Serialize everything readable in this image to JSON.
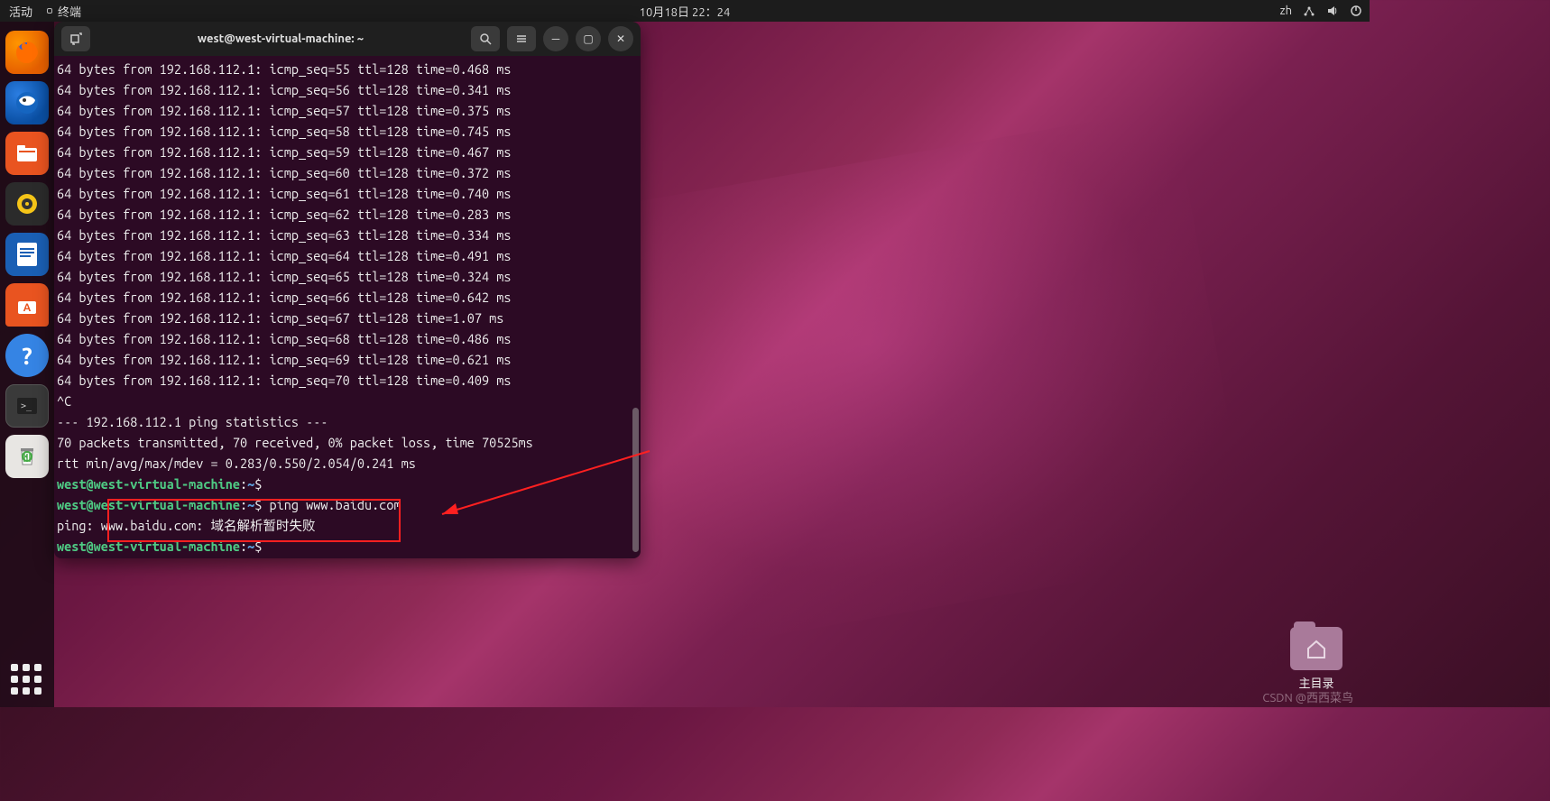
{
  "topbar": {
    "activities": "活动",
    "app_label": "终端",
    "datetime": "10月18日  22：24",
    "lang": "zh"
  },
  "dock": {
    "items": [
      {
        "name": "firefox"
      },
      {
        "name": "thunderbird"
      },
      {
        "name": "files"
      },
      {
        "name": "rhythmbox"
      },
      {
        "name": "libreoffice-writer"
      },
      {
        "name": "ubuntu-software"
      },
      {
        "name": "help"
      },
      {
        "name": "terminal"
      },
      {
        "name": "trash"
      }
    ]
  },
  "terminal": {
    "title": "west@west-virtual-machine: ~",
    "ping_ip": "192.168.112.1",
    "ping_lines": [
      {
        "seq": 55,
        "ttl": 128,
        "time": "0.468"
      },
      {
        "seq": 56,
        "ttl": 128,
        "time": "0.341"
      },
      {
        "seq": 57,
        "ttl": 128,
        "time": "0.375"
      },
      {
        "seq": 58,
        "ttl": 128,
        "time": "0.745"
      },
      {
        "seq": 59,
        "ttl": 128,
        "time": "0.467"
      },
      {
        "seq": 60,
        "ttl": 128,
        "time": "0.372"
      },
      {
        "seq": 61,
        "ttl": 128,
        "time": "0.740"
      },
      {
        "seq": 62,
        "ttl": 128,
        "time": "0.283"
      },
      {
        "seq": 63,
        "ttl": 128,
        "time": "0.334"
      },
      {
        "seq": 64,
        "ttl": 128,
        "time": "0.491"
      },
      {
        "seq": 65,
        "ttl": 128,
        "time": "0.324"
      },
      {
        "seq": 66,
        "ttl": 128,
        "time": "0.642"
      },
      {
        "seq": 67,
        "ttl": 128,
        "time": "1.07"
      },
      {
        "seq": 68,
        "ttl": 128,
        "time": "0.486"
      },
      {
        "seq": 69,
        "ttl": 128,
        "time": "0.621"
      },
      {
        "seq": 70,
        "ttl": 128,
        "time": "0.409"
      }
    ],
    "interrupt": "^C",
    "stats_header": "--- 192.168.112.1 ping statistics ---",
    "stats_line1": "70 packets transmitted, 70 received, 0% packet loss, time 70525ms",
    "stats_line2": "rtt min/avg/max/mdev = 0.283/0.550/2.054/0.241 ms",
    "prompt_user": "west@west-virtual-machine",
    "prompt_sep": ":",
    "prompt_path": "~",
    "prompt_char": "$",
    "cmd2": "ping www.baidu.com",
    "cmd2_out": "ping: www.baidu.com: 域名解析暂时失败"
  },
  "home_folder": {
    "label": "主目录"
  },
  "watermark": "CSDN @西西菜鸟"
}
